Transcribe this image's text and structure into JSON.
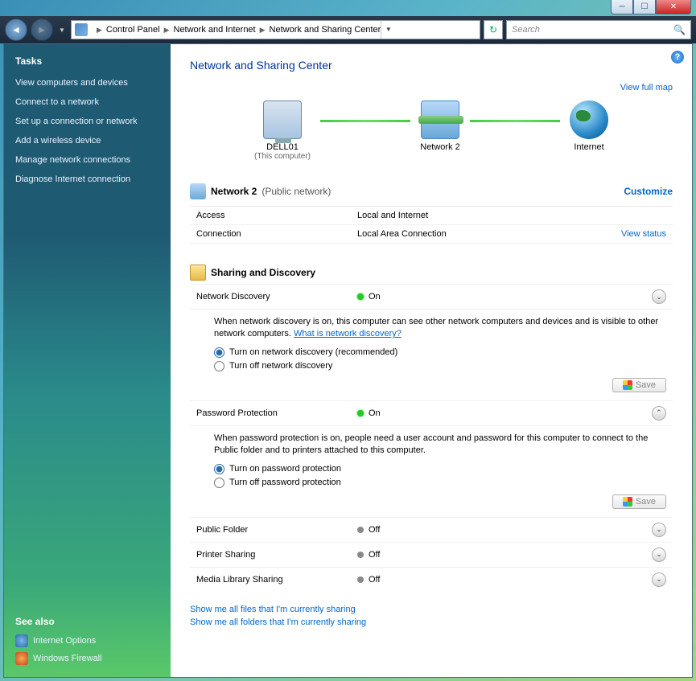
{
  "breadcrumb": {
    "seg1": "Control Panel",
    "seg2": "Network and Internet",
    "seg3": "Network and Sharing Center"
  },
  "search": {
    "placeholder": "Search"
  },
  "sidebar": {
    "tasks_hdr": "Tasks",
    "items": [
      "View computers and devices",
      "Connect to a network",
      "Set up a connection or network",
      "Add a wireless device",
      "Manage network connections",
      "Diagnose Internet connection"
    ],
    "see_also_hdr": "See also",
    "see_also": [
      {
        "label": "Internet Options"
      },
      {
        "label": "Windows Firewall"
      }
    ]
  },
  "main": {
    "title": "Network and Sharing Center",
    "view_full_map": "View full map",
    "nodes": {
      "pc_name": "DELL01",
      "pc_sub": "(This computer)",
      "net_name": "Network 2",
      "internet": "Internet"
    },
    "network_section": {
      "name": "Network 2",
      "type": "(Public network)",
      "customize": "Customize",
      "rows": [
        {
          "k": "Access",
          "v": "Local and Internet",
          "action": ""
        },
        {
          "k": "Connection",
          "v": "Local Area Connection",
          "action": "View status"
        }
      ]
    },
    "sharing_hdr": "Sharing and Discovery",
    "discovery": {
      "label": "Network Discovery",
      "status": "On",
      "desc": "When network discovery is on, this computer can see other network computers and devices and is visible to other network computers. ",
      "what_link": "What is network discovery?",
      "opt_on": "Turn on network discovery (recommended)",
      "opt_off": "Turn off network discovery",
      "save": "Save"
    },
    "password": {
      "label": "Password Protection",
      "status": "On",
      "desc": "When password protection is on, people need a user account and password for this computer to connect to the Public folder and to printers attached to this computer.",
      "opt_on": "Turn on password protection",
      "opt_off": "Turn off password protection",
      "save": "Save"
    },
    "collapsed": [
      {
        "label": "Public Folder",
        "status": "Off"
      },
      {
        "label": "Printer Sharing",
        "status": "Off"
      },
      {
        "label": "Media Library Sharing",
        "status": "Off"
      }
    ],
    "footer": {
      "files": "Show me all files that I'm currently sharing",
      "folders": "Show me all folders that I'm currently sharing"
    }
  }
}
